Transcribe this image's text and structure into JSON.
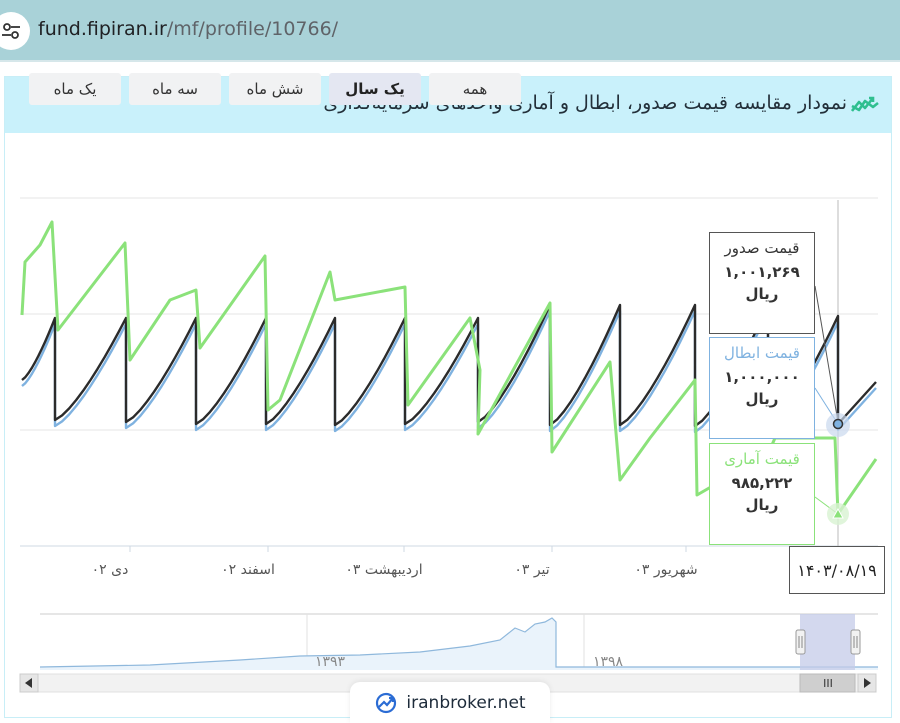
{
  "browser": {
    "url_host": "fund.fipiran.ir",
    "url_path": "/mf/profile/10766/"
  },
  "card": {
    "title": "نمودار مقایسه قیمت صدور، ابطال و آماری واحدهای سرمایه‌گذاری"
  },
  "range_selector": {
    "buttons": [
      {
        "label": "همه",
        "active": false
      },
      {
        "label": "یک سال",
        "active": true
      },
      {
        "label": "شش ماه",
        "active": false
      },
      {
        "label": "سه ماه",
        "active": false
      },
      {
        "label": "یک ماه",
        "active": false
      }
    ]
  },
  "chart_data": {
    "type": "line",
    "x_tick_labels": [
      "دی ۰۲",
      "اسفند ۰۲",
      "اردیبهشت ۰۳",
      "تیر ۰۳",
      "شهریور ۰۳"
    ],
    "series": [
      {
        "name": "قیمت صدور",
        "color": "#2b2b2b"
      },
      {
        "name": "قیمت ابطال",
        "color": "#7fb2e0"
      },
      {
        "name": "قیمت آماری",
        "color": "#8be27a"
      }
    ],
    "tooltip_date": "۱۴۰۳/۰۸/۱۹",
    "tooltip": [
      {
        "title": "قیمت صدور",
        "value": "۱,۰۰۱,۲۶۹",
        "unit": "ریال",
        "color": "#333333"
      },
      {
        "title": "قیمت ابطال",
        "value": "۱,۰۰۰,۰۰۰",
        "unit": "ریال",
        "color": "#7fb2e0"
      },
      {
        "title": "قیمت آماری",
        "value": "۹۸۵,۲۲۲",
        "unit": "ریال",
        "color": "#8be27a"
      }
    ],
    "navigator_labels": [
      "۱۳۹۳",
      "۱۳۹۸"
    ],
    "scrollbar_grip": "III"
  },
  "watermark": {
    "text": "iranbroker.net"
  }
}
